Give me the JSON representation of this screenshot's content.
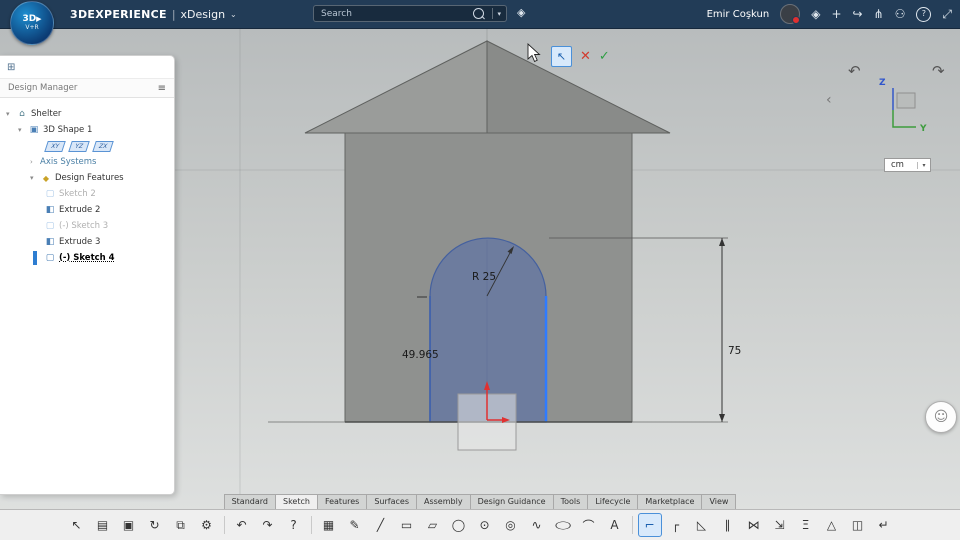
{
  "topbar": {
    "logo": {
      "line1": "3D",
      "play": "▶",
      "line2": "V+R"
    },
    "brand": "3DEXPERIENCE",
    "divider": "|",
    "app_name": "xDesign",
    "caret": "⌄",
    "tag_icon": "◈",
    "user_name": "Emir Coşkun",
    "icons": {
      "compass": "◈",
      "add": "+",
      "share": "↪",
      "network": "⋔",
      "invite": "⚇",
      "help": "?",
      "fullscreen": "⤢"
    }
  },
  "search": {
    "placeholder": "Search",
    "caret": "▾"
  },
  "design_manager": {
    "panel_icon": "⊞",
    "title": "Design Manager",
    "menu_icon": "≡",
    "tree": {
      "carets": {
        "open": "▾",
        "closed": "›"
      },
      "icons": {
        "home": "⌂",
        "cube": "▣",
        "feature": "◆",
        "sketch": "▢",
        "extrude": "◧"
      },
      "root_label": "Shelter",
      "shape_label": "3D Shape 1",
      "planes": [
        "XY",
        "YZ",
        "ZX"
      ],
      "axis_systems_label": "Axis Systems",
      "design_features_label": "Design Features",
      "features": [
        {
          "label": "Sketch 2"
        },
        {
          "label": "Extrude 2"
        },
        {
          "label": "(-) Sketch 3"
        },
        {
          "label": "Extrude 3"
        },
        {
          "label": "(-) Sketch 4"
        }
      ]
    }
  },
  "viewport": {
    "mini_toolbar": {
      "pointer": "↖",
      "cancel": "✕",
      "confirm": "✓"
    },
    "dimensions": {
      "radius": "R 25",
      "width": "49.965",
      "height": "75"
    },
    "units_value": "cm",
    "units_caret": "▾",
    "axes": {
      "z": "Z",
      "y": "Y"
    },
    "nav": {
      "rotate_left": "↶",
      "rotate_right": "↷",
      "collapse": "‹",
      "assistant": "☺"
    }
  },
  "tabs": [
    {
      "label": "Standard"
    },
    {
      "label": "Sketch"
    },
    {
      "label": "Features"
    },
    {
      "label": "Surfaces"
    },
    {
      "label": "Assembly"
    },
    {
      "label": "Design Guidance"
    },
    {
      "label": "Tools"
    },
    {
      "label": "Lifecycle"
    },
    {
      "label": "Marketplace"
    },
    {
      "label": "View"
    }
  ],
  "toolbar": {
    "icons": [
      {
        "name": "select-tool",
        "glyph": "↖"
      },
      {
        "name": "paste",
        "glyph": "▤"
      },
      {
        "name": "save",
        "glyph": "▣"
      },
      {
        "name": "update",
        "glyph": "↻"
      },
      {
        "name": "copy",
        "glyph": "⧉"
      },
      {
        "name": "settings",
        "glyph": "⚙"
      },
      {
        "name": "undo",
        "glyph": "↶"
      },
      {
        "name": "redo",
        "glyph": "↷"
      },
      {
        "name": "help",
        "glyph": "?"
      },
      {
        "name": "grid",
        "glyph": "▦"
      },
      {
        "name": "sketch-pencil",
        "glyph": "✎"
      },
      {
        "name": "line",
        "glyph": "╱"
      },
      {
        "name": "rectangle",
        "glyph": "▭"
      },
      {
        "name": "parallelogram",
        "glyph": "▱"
      },
      {
        "name": "circle",
        "glyph": "◯"
      },
      {
        "name": "center-circle",
        "glyph": "⊙"
      },
      {
        "name": "concentric-circle",
        "glyph": "◎"
      },
      {
        "name": "spline",
        "glyph": "∿"
      },
      {
        "name": "ellipse",
        "glyph": "◯"
      },
      {
        "name": "arc",
        "glyph": "⌒"
      },
      {
        "name": "text",
        "glyph": "A"
      },
      {
        "name": "power-trim",
        "glyph": "⌐"
      },
      {
        "name": "corner",
        "glyph": "┌"
      },
      {
        "name": "chamfer",
        "glyph": "◺"
      },
      {
        "name": "offset",
        "glyph": "∥"
      },
      {
        "name": "mirror",
        "glyph": "⋈"
      },
      {
        "name": "project",
        "glyph": "⇲"
      },
      {
        "name": "constraints",
        "glyph": "Ξ"
      },
      {
        "name": "triangle",
        "glyph": "△"
      },
      {
        "name": "extrude-profile",
        "glyph": "◫"
      },
      {
        "name": "exit-sketch",
        "glyph": "↵"
      }
    ]
  }
}
